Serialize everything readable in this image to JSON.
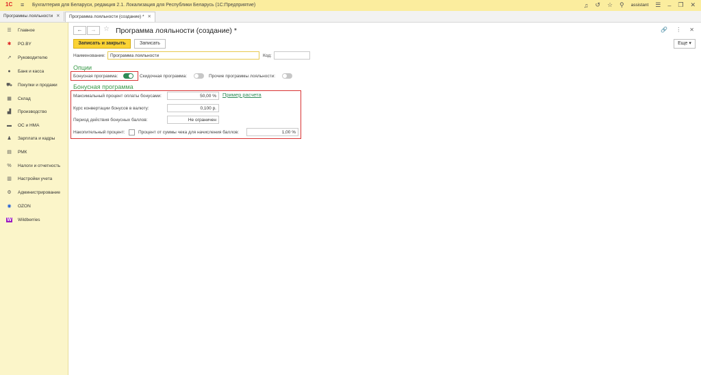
{
  "app": {
    "logo": "1С",
    "title": "Бухгалтерия для Беларуси, редакция 2.1. Локализация для Республики Беларусь   (1С:Предприятие)",
    "user": "assistant"
  },
  "tabs": [
    {
      "label": "Программы лояльности"
    },
    {
      "label": "Программа лояльности (создание) *"
    }
  ],
  "sidebar": {
    "items": [
      {
        "label": "Главное",
        "icon": "menu-icon"
      },
      {
        "label": "PO.BY",
        "icon": "po-icon"
      },
      {
        "label": "Руководителю",
        "icon": "chart-line-icon"
      },
      {
        "label": "Банк и касса",
        "icon": "bank-icon"
      },
      {
        "label": "Покупки и продажи",
        "icon": "cart-icon"
      },
      {
        "label": "Склад",
        "icon": "warehouse-icon"
      },
      {
        "label": "Производство",
        "icon": "factory-icon"
      },
      {
        "label": "ОС и НМА",
        "icon": "truck-icon"
      },
      {
        "label": "Зарплата и кадры",
        "icon": "person-icon"
      },
      {
        "label": "РМК",
        "icon": "register-icon"
      },
      {
        "label": "Налоги и отчетность",
        "icon": "percent-icon"
      },
      {
        "label": "Настройки учета",
        "icon": "document-icon"
      },
      {
        "label": "Администрирование",
        "icon": "gear-icon"
      },
      {
        "label": "OZON",
        "icon": "ozon-icon"
      },
      {
        "label": "Wildberries",
        "icon": "wildberries-icon"
      }
    ]
  },
  "form": {
    "title": "Программа лояльности (создание) *",
    "save_close": "Записать и закрыть",
    "save": "Записать",
    "more": "Еще",
    "name_label": "Наименование:",
    "name_value": "Программа лояльности",
    "code_label": "Код:",
    "code_value": "",
    "options_header": "Опции",
    "bonus_program_label": "Бонусная программа:",
    "bonus_program_on": true,
    "discount_program_label": "Скидочная программа:",
    "discount_program_on": false,
    "other_programs_label": "Прочие программы лояльности:",
    "other_programs_on": false,
    "bonus_section_header": "Бонусная программа",
    "max_percent_label": "Максимальный процент оплаты бонусами:",
    "max_percent_value": "50,00 %",
    "example_link": "Пример расчета",
    "conversion_label": "Курс конвертации бонусов в валюту:",
    "conversion_value": "0,100 р.",
    "period_label": "Период действия бонусных баллов:",
    "period_value": "Не ограничен",
    "cumulative_label": "Накопительный процент:",
    "cumulative_checked": false,
    "check_percent_label": "Процент от суммы чека для начисления баллов:",
    "check_percent_value": "1,00 %"
  },
  "colors": {
    "titlebar": "#fbed9e",
    "sidebar": "#fbf5c9",
    "primary_button": "#fbd334",
    "accent_green": "#3a9a4a",
    "highlight_red": "#d83030"
  }
}
